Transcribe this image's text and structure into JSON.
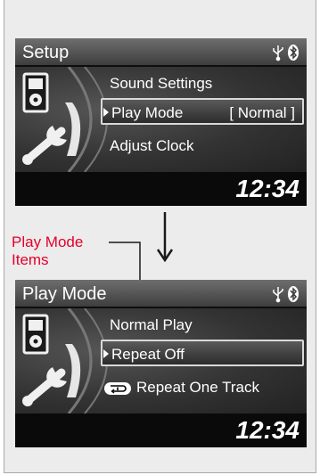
{
  "screen1": {
    "title": "Setup",
    "items": [
      {
        "label": "Sound Settings"
      },
      {
        "label": "Play Mode",
        "value": "[ Normal ]"
      },
      {
        "label": "Adjust Clock"
      }
    ],
    "clock": "12:34",
    "icons": [
      "usb-icon",
      "bluetooth-icon"
    ]
  },
  "callout": {
    "line1": "Play Mode",
    "line2": "Items",
    "color": "#e4002b"
  },
  "screen2": {
    "title": "Play Mode",
    "items": [
      {
        "label": "Normal Play"
      },
      {
        "label": "Repeat Off"
      },
      {
        "label": "Repeat One Track",
        "icon": "repeat-one-icon"
      }
    ],
    "clock": "12:34",
    "icons": [
      "usb-icon",
      "bluetooth-icon"
    ]
  }
}
